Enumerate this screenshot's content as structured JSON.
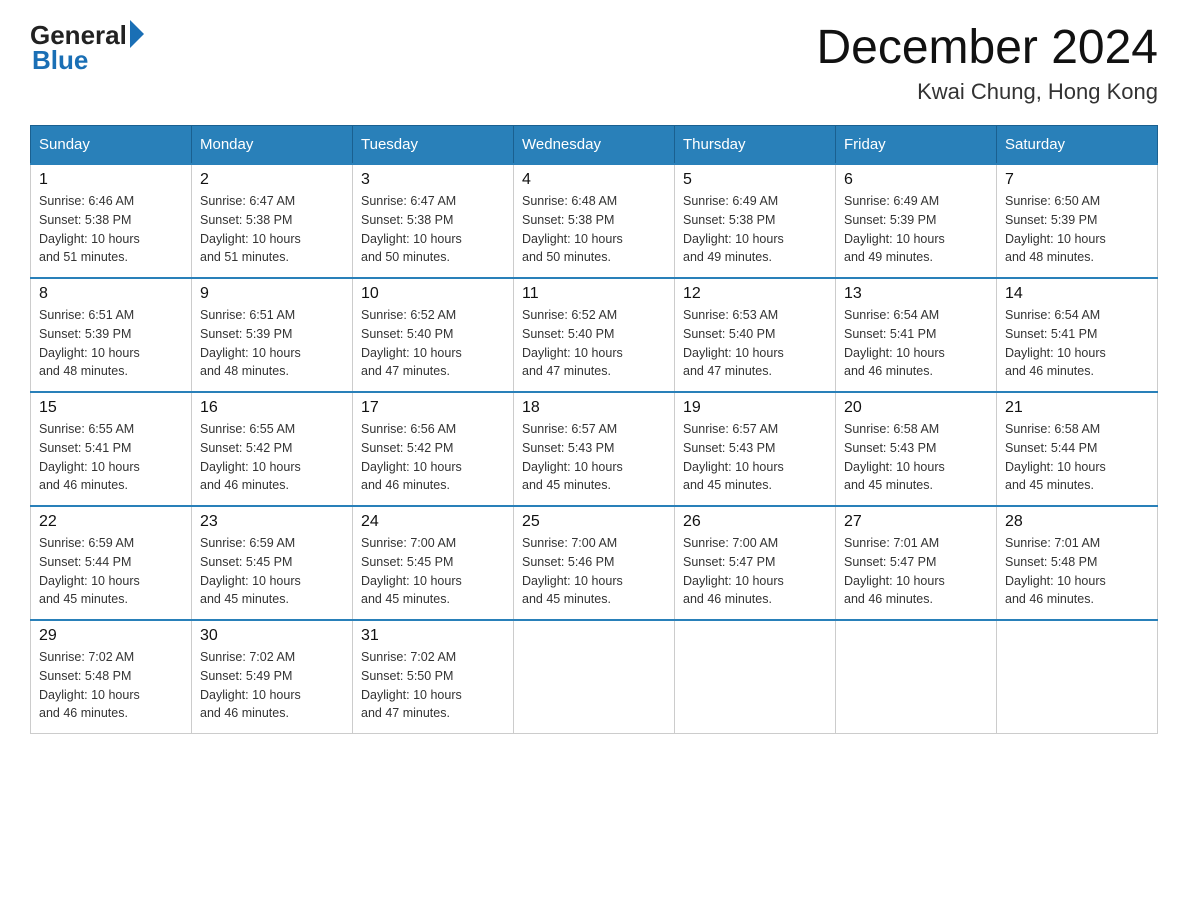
{
  "logo": {
    "general": "General",
    "blue": "Blue"
  },
  "title": "December 2024",
  "subtitle": "Kwai Chung, Hong Kong",
  "days_header": [
    "Sunday",
    "Monday",
    "Tuesday",
    "Wednesday",
    "Thursday",
    "Friday",
    "Saturday"
  ],
  "weeks": [
    [
      {
        "day": "1",
        "sunrise": "6:46 AM",
        "sunset": "5:38 PM",
        "daylight": "10 hours and 51 minutes."
      },
      {
        "day": "2",
        "sunrise": "6:47 AM",
        "sunset": "5:38 PM",
        "daylight": "10 hours and 51 minutes."
      },
      {
        "day": "3",
        "sunrise": "6:47 AM",
        "sunset": "5:38 PM",
        "daylight": "10 hours and 50 minutes."
      },
      {
        "day": "4",
        "sunrise": "6:48 AM",
        "sunset": "5:38 PM",
        "daylight": "10 hours and 50 minutes."
      },
      {
        "day": "5",
        "sunrise": "6:49 AM",
        "sunset": "5:38 PM",
        "daylight": "10 hours and 49 minutes."
      },
      {
        "day": "6",
        "sunrise": "6:49 AM",
        "sunset": "5:39 PM",
        "daylight": "10 hours and 49 minutes."
      },
      {
        "day": "7",
        "sunrise": "6:50 AM",
        "sunset": "5:39 PM",
        "daylight": "10 hours and 48 minutes."
      }
    ],
    [
      {
        "day": "8",
        "sunrise": "6:51 AM",
        "sunset": "5:39 PM",
        "daylight": "10 hours and 48 minutes."
      },
      {
        "day": "9",
        "sunrise": "6:51 AM",
        "sunset": "5:39 PM",
        "daylight": "10 hours and 48 minutes."
      },
      {
        "day": "10",
        "sunrise": "6:52 AM",
        "sunset": "5:40 PM",
        "daylight": "10 hours and 47 minutes."
      },
      {
        "day": "11",
        "sunrise": "6:52 AM",
        "sunset": "5:40 PM",
        "daylight": "10 hours and 47 minutes."
      },
      {
        "day": "12",
        "sunrise": "6:53 AM",
        "sunset": "5:40 PM",
        "daylight": "10 hours and 47 minutes."
      },
      {
        "day": "13",
        "sunrise": "6:54 AM",
        "sunset": "5:41 PM",
        "daylight": "10 hours and 46 minutes."
      },
      {
        "day": "14",
        "sunrise": "6:54 AM",
        "sunset": "5:41 PM",
        "daylight": "10 hours and 46 minutes."
      }
    ],
    [
      {
        "day": "15",
        "sunrise": "6:55 AM",
        "sunset": "5:41 PM",
        "daylight": "10 hours and 46 minutes."
      },
      {
        "day": "16",
        "sunrise": "6:55 AM",
        "sunset": "5:42 PM",
        "daylight": "10 hours and 46 minutes."
      },
      {
        "day": "17",
        "sunrise": "6:56 AM",
        "sunset": "5:42 PM",
        "daylight": "10 hours and 46 minutes."
      },
      {
        "day": "18",
        "sunrise": "6:57 AM",
        "sunset": "5:43 PM",
        "daylight": "10 hours and 45 minutes."
      },
      {
        "day": "19",
        "sunrise": "6:57 AM",
        "sunset": "5:43 PM",
        "daylight": "10 hours and 45 minutes."
      },
      {
        "day": "20",
        "sunrise": "6:58 AM",
        "sunset": "5:43 PM",
        "daylight": "10 hours and 45 minutes."
      },
      {
        "day": "21",
        "sunrise": "6:58 AM",
        "sunset": "5:44 PM",
        "daylight": "10 hours and 45 minutes."
      }
    ],
    [
      {
        "day": "22",
        "sunrise": "6:59 AM",
        "sunset": "5:44 PM",
        "daylight": "10 hours and 45 minutes."
      },
      {
        "day": "23",
        "sunrise": "6:59 AM",
        "sunset": "5:45 PM",
        "daylight": "10 hours and 45 minutes."
      },
      {
        "day": "24",
        "sunrise": "7:00 AM",
        "sunset": "5:45 PM",
        "daylight": "10 hours and 45 minutes."
      },
      {
        "day": "25",
        "sunrise": "7:00 AM",
        "sunset": "5:46 PM",
        "daylight": "10 hours and 45 minutes."
      },
      {
        "day": "26",
        "sunrise": "7:00 AM",
        "sunset": "5:47 PM",
        "daylight": "10 hours and 46 minutes."
      },
      {
        "day": "27",
        "sunrise": "7:01 AM",
        "sunset": "5:47 PM",
        "daylight": "10 hours and 46 minutes."
      },
      {
        "day": "28",
        "sunrise": "7:01 AM",
        "sunset": "5:48 PM",
        "daylight": "10 hours and 46 minutes."
      }
    ],
    [
      {
        "day": "29",
        "sunrise": "7:02 AM",
        "sunset": "5:48 PM",
        "daylight": "10 hours and 46 minutes."
      },
      {
        "day": "30",
        "sunrise": "7:02 AM",
        "sunset": "5:49 PM",
        "daylight": "10 hours and 46 minutes."
      },
      {
        "day": "31",
        "sunrise": "7:02 AM",
        "sunset": "5:50 PM",
        "daylight": "10 hours and 47 minutes."
      },
      null,
      null,
      null,
      null
    ]
  ],
  "labels": {
    "sunrise": "Sunrise:",
    "sunset": "Sunset:",
    "daylight": "Daylight:"
  }
}
